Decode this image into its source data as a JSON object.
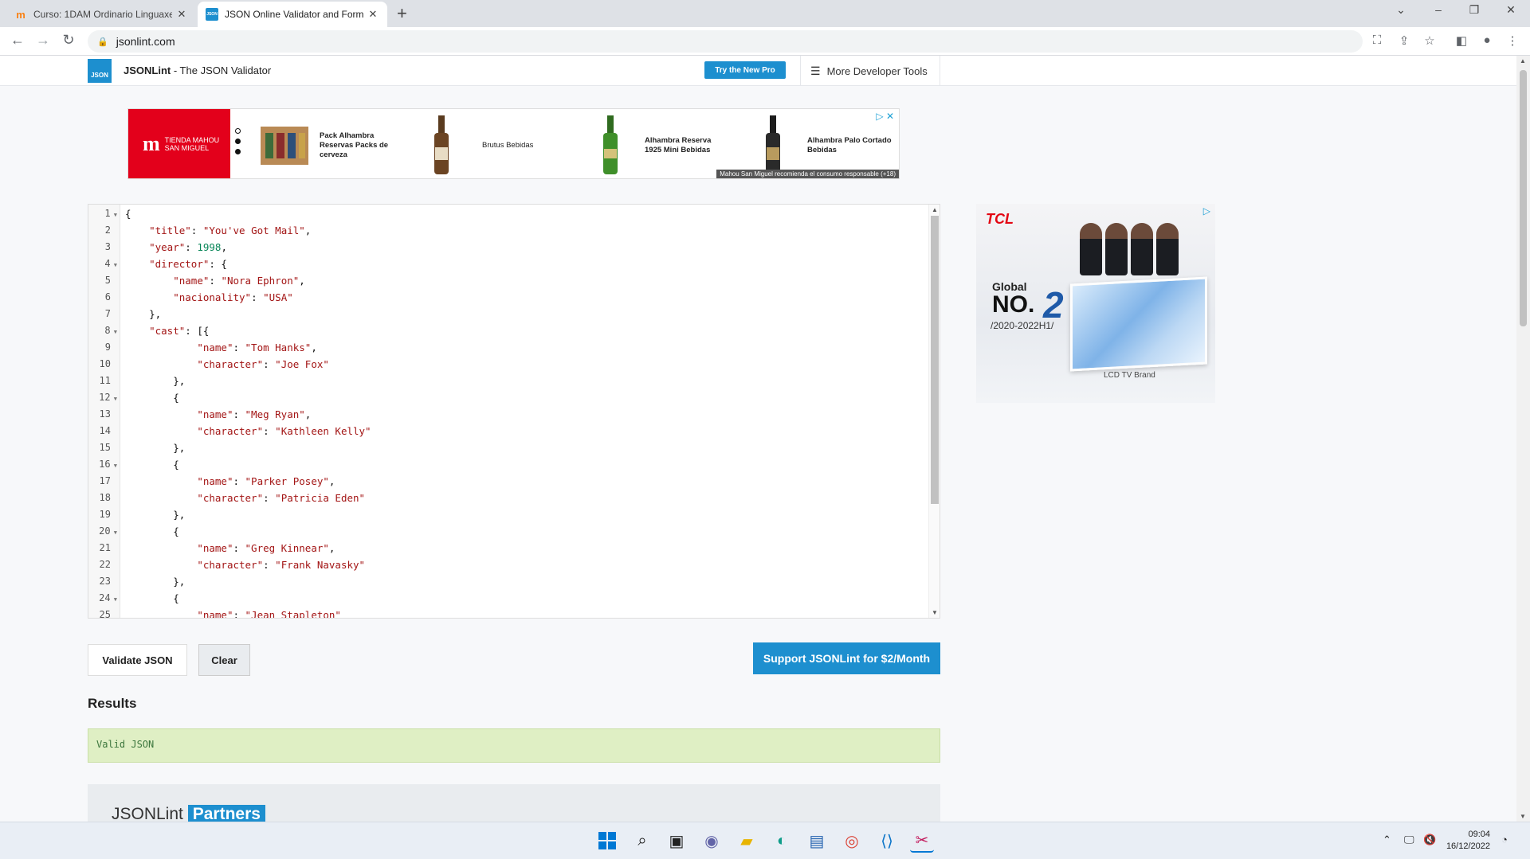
{
  "browser": {
    "tabs": [
      {
        "title": "Curso: 1DAM Ordinario Linguaxe",
        "active": false
      },
      {
        "title": "JSON Online Validator and Forma",
        "active": true
      }
    ],
    "url": "jsonlint.com"
  },
  "site": {
    "logo_text": "JSON",
    "brand_name": "JSONLint",
    "brand_tagline": " - The JSON Validator",
    "pro_button": "Try the New Pro",
    "dev_tools": "More Developer Tools"
  },
  "top_ad": {
    "logo_line1": "TIENDA MAHOU",
    "logo_line2": "SAN MIGUEL",
    "products": [
      "Pack Alhambra Reservas Packs de cerveza",
      "Brutus Bebidas",
      "Alhambra Reserva 1925 Mini Bebidas",
      "Alhambra Palo Cortado Bebidas"
    ],
    "footer": "Mahou San Miguel recomienda el consumo responsable (+18)"
  },
  "editor": {
    "line_numbers": [
      "1",
      "2",
      "3",
      "4",
      "5",
      "6",
      "7",
      "8",
      "9",
      "10",
      "11",
      "12",
      "13",
      "14",
      "15",
      "16",
      "17",
      "18",
      "19",
      "20",
      "21",
      "22",
      "23",
      "24",
      "25"
    ],
    "fold_lines": [
      1,
      4,
      8,
      12,
      16,
      20,
      24
    ],
    "lines": [
      "{",
      "    \"title\": \"You've Got Mail\",",
      "    \"year\": 1998,",
      "    \"director\": {",
      "        \"name\": \"Nora Ephron\",",
      "        \"nacionality\": \"USA\"",
      "    },",
      "    \"cast\": [{",
      "            \"name\": \"Tom Hanks\",",
      "            \"character\": \"Joe Fox\"",
      "        },",
      "        {",
      "            \"name\": \"Meg Ryan\",",
      "            \"character\": \"Kathleen Kelly\"",
      "        },",
      "        {",
      "            \"name\": \"Parker Posey\",",
      "            \"character\": \"Patricia Eden\"",
      "        },",
      "        {",
      "            \"name\": \"Greg Kinnear\",",
      "            \"character\": \"Frank Navasky\"",
      "        },",
      "        {",
      "            \"name\": \"Jean Stapleton\""
    ]
  },
  "side_ad": {
    "brand": "TCL",
    "global": "Global",
    "rank_prefix": "NO.",
    "rank": "2",
    "period": "/2020-2022H1/",
    "tv_label": "LCD TV Brand"
  },
  "actions": {
    "validate": "Validate JSON",
    "clear": "Clear",
    "support": "Support JSONLint for $2/Month"
  },
  "results": {
    "heading": "Results",
    "message": "Valid JSON"
  },
  "partners": {
    "prefix": "JSONLint",
    "highlight": "Partners"
  },
  "taskbar": {
    "time": "09:04",
    "date": "16/12/2022"
  },
  "colors": {
    "accent": "#1d8fcf",
    "valid_bg": "#dfefc4",
    "json_key": "#a31515",
    "json_number": "#098658"
  }
}
